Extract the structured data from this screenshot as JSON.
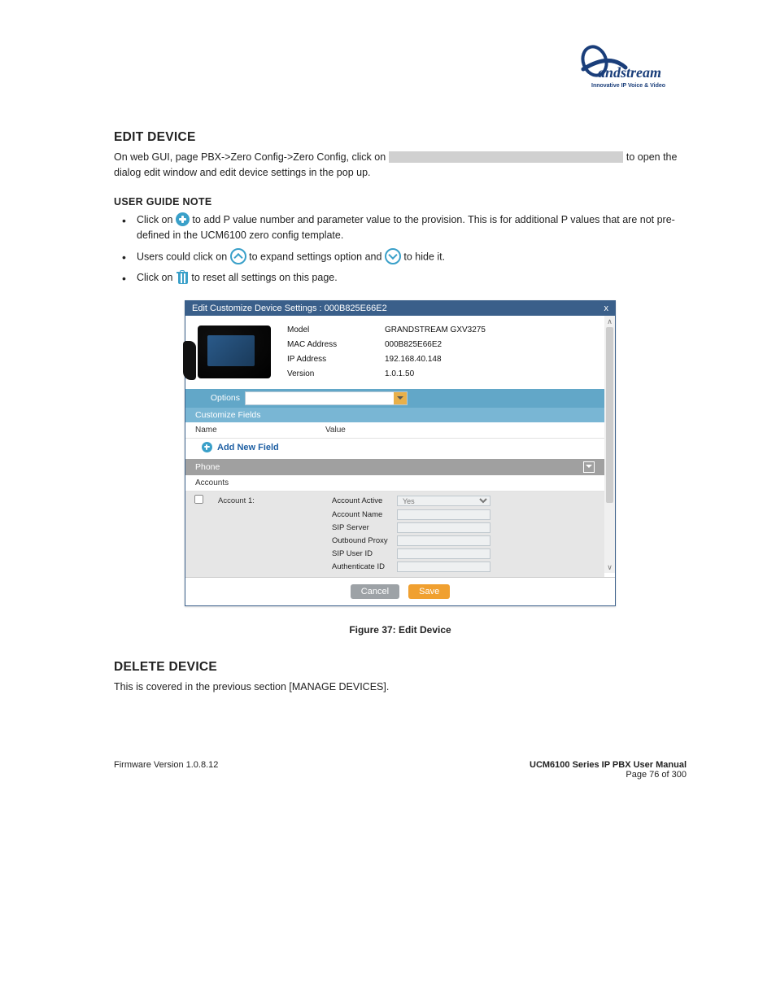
{
  "logo": {
    "brand": "Grandstream",
    "tagline": "Innovative IP Voice & Video"
  },
  "section1": {
    "title": "EDIT DEVICE",
    "para": "On web GUI, page PBX->Zero Config->Zero Config, click on                                                                   to open the dialog edit window and edit device settings in the pop up.",
    "guide_heading": "USER GUIDE NOTE",
    "bullet1_pre": "Click on ",
    "bullet1_post": " to add P value number and parameter value to the provision. This is for additional P values that are not pre-defined in the UCM6100 zero config template.",
    "bullet2_pre": "Users could click on ",
    "bullet2_mid": " to expand settings option and ",
    "bullet2_post": " to hide it.",
    "bullet3_pre": "Click on ",
    "bullet3_post": " to reset all settings on this page."
  },
  "screenshot": {
    "title_prefix": "Edit Customize Device Settings : ",
    "mac_title": "000B825E66E2",
    "close": "x",
    "info": {
      "model_label": "Model",
      "model_value": "GRANDSTREAM GXV3275",
      "mac_label": "MAC Address",
      "mac_value": "000B825E66E2",
      "ip_label": "IP Address",
      "ip_value": "192.168.40.148",
      "ver_label": "Version",
      "ver_value": "1.0.1.50"
    },
    "options_label": "Options",
    "cust_fields": "Customize Fields",
    "col_name": "Name",
    "col_value": "Value",
    "add_new_field": "Add New Field",
    "phone": "Phone",
    "accounts": "Accounts",
    "account1": "Account 1:",
    "fields": {
      "active_label": "Account Active",
      "active_value": "Yes",
      "name_label": "Account Name",
      "sip_label": "SIP Server",
      "proxy_label": "Outbound Proxy",
      "userid_label": "SIP User ID",
      "authid_label": "Authenticate ID"
    },
    "cancel": "Cancel",
    "save": "Save"
  },
  "figure_caption": "Figure 37: Edit Device",
  "section2": {
    "title": "DELETE DEVICE",
    "para": "This is covered in the previous section [MANAGE DEVICES]."
  },
  "footer": {
    "left": "Firmware Version 1.0.8.12",
    "right_title": "UCM6100 Series IP PBX User Manual",
    "right_page": "Page 76 of 300"
  }
}
